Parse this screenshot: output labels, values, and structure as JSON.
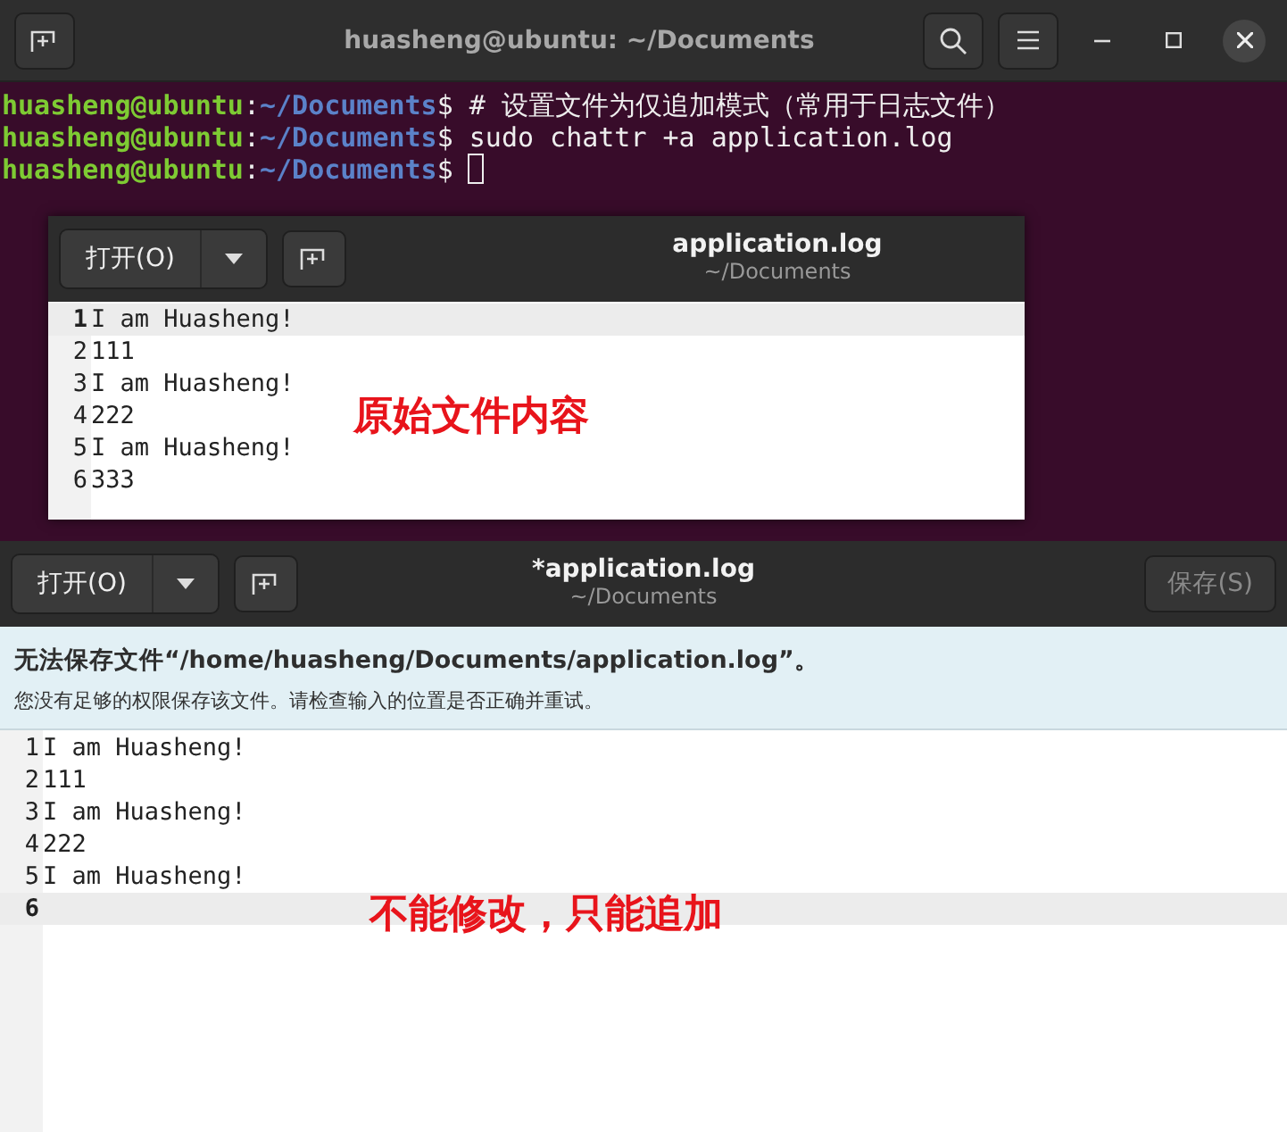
{
  "terminal": {
    "title": "huasheng@ubuntu: ~/Documents",
    "lines": [
      {
        "user": "huasheng@ubuntu",
        "sep": ":",
        "path": "~/Documents",
        "prompt": "$",
        "command": "# 设置文件为仅追加模式（常用于日志文件）",
        "cursor": false
      },
      {
        "user": "huasheng@ubuntu",
        "sep": ":",
        "path": "~/Documents",
        "prompt": "$",
        "command": "sudo chattr +a application.log",
        "cursor": false
      },
      {
        "user": "huasheng@ubuntu",
        "sep": ":",
        "path": "~/Documents",
        "prompt": "$",
        "cursor": true
      }
    ]
  },
  "editors": [
    {
      "open_button": "打开(O)",
      "title": "application.log",
      "subtitle": "~/Documents",
      "lines": [
        {
          "number": "1",
          "text": "I am Huasheng!",
          "current": true
        },
        {
          "number": "2",
          "text": "111",
          "current": false
        },
        {
          "number": "3",
          "text": "I am Huasheng!",
          "current": false
        },
        {
          "number": "4",
          "text": "222",
          "current": false
        },
        {
          "number": "5",
          "text": "I am Huasheng!",
          "current": false
        },
        {
          "number": "6",
          "text": "333",
          "current": false
        }
      ],
      "annotation": "原始文件内容"
    },
    {
      "open_button": "打开(O)",
      "title": "*application.log",
      "subtitle": "~/Documents",
      "save_button": {
        "label": "保存(S)",
        "disabled": true
      },
      "infobar": {
        "title": "无法保存文件“/home/huasheng/Documents/application.log”。",
        "message": "您没有足够的权限保存该文件。请检查输入的位置是否正确并重试。"
      },
      "lines": [
        {
          "number": "1",
          "text": "I am Huasheng!",
          "current": false
        },
        {
          "number": "2",
          "text": "111",
          "current": false
        },
        {
          "number": "3",
          "text": "I am Huasheng!",
          "current": false
        },
        {
          "number": "4",
          "text": "222",
          "current": false
        },
        {
          "number": "5",
          "text": "I am Huasheng!",
          "current": false
        },
        {
          "number": "6",
          "current": true
        }
      ],
      "annotation": "不能修改，只能追加"
    }
  ]
}
